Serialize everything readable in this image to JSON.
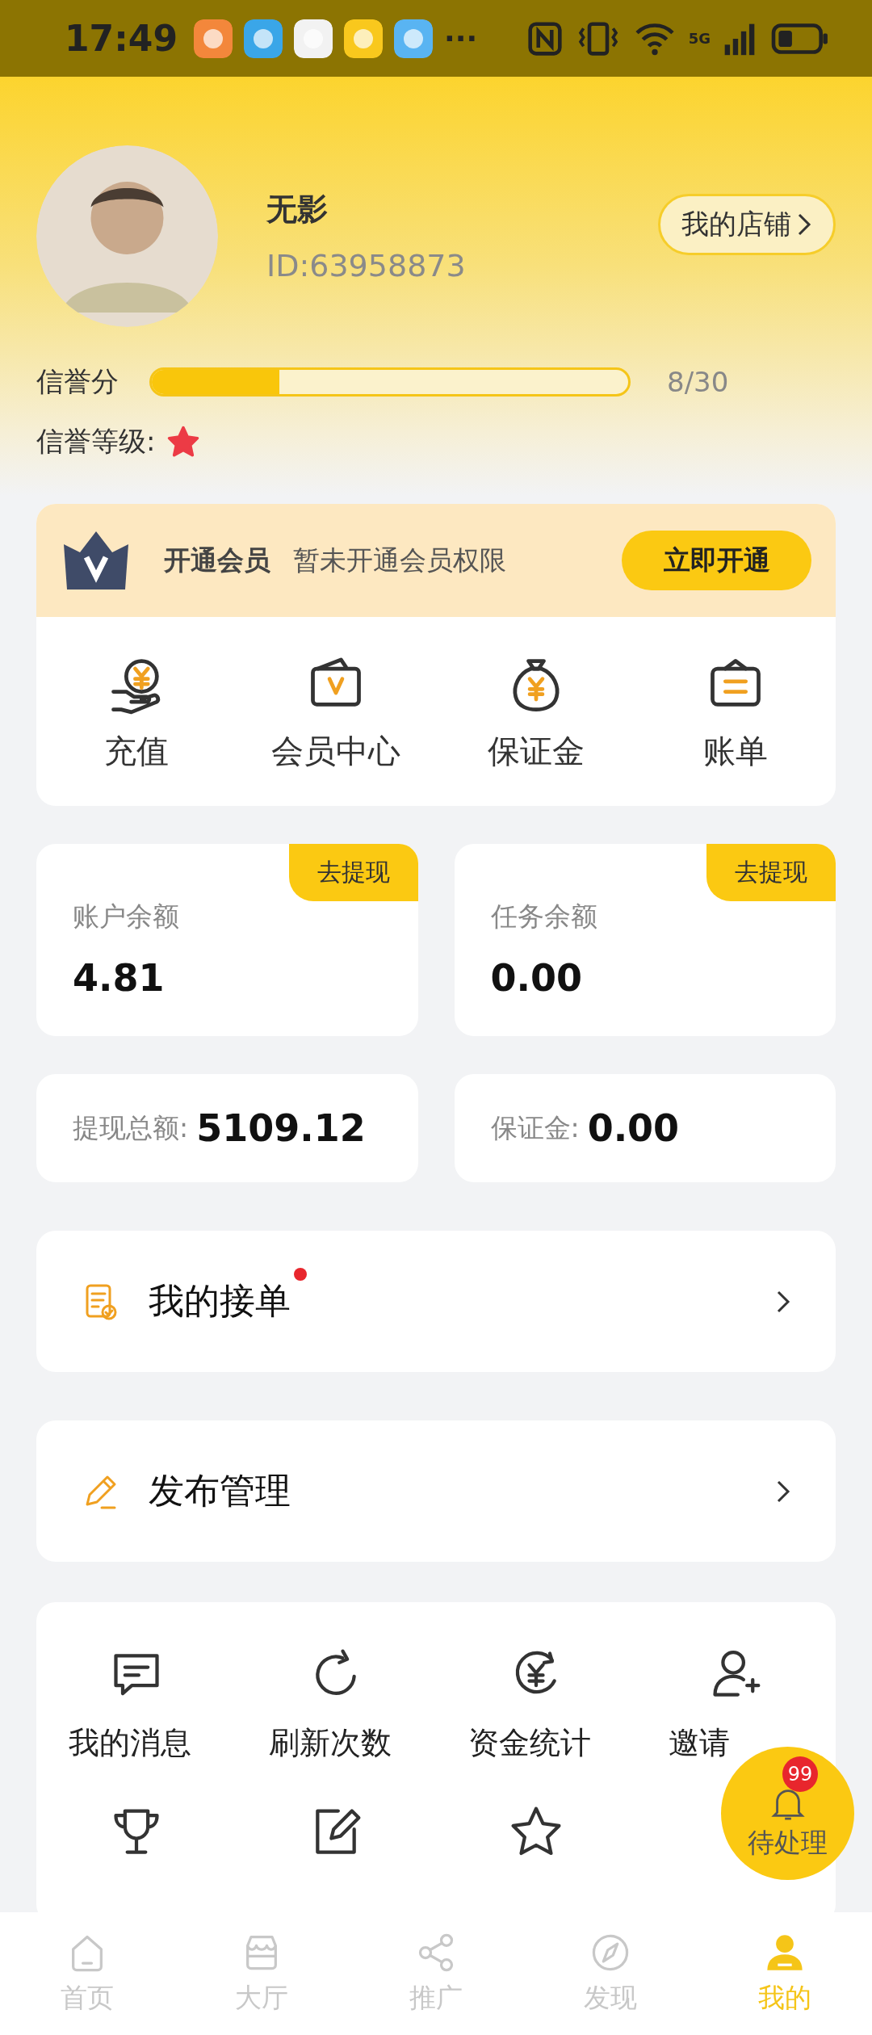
{
  "status_bar": {
    "time": "17:49",
    "more": "···",
    "network": "5G"
  },
  "profile": {
    "name": "无影",
    "id": "ID:63958873",
    "store_button": "我的店铺"
  },
  "credit": {
    "label": "信誉分",
    "level": 0.267,
    "reading": "8/30"
  },
  "credit_level": {
    "label": "信誉等级:"
  },
  "membership": {
    "title": "开通会员",
    "note": "暂未开通会员权限",
    "button": "立即开通"
  },
  "quick_actions": [
    {
      "label": "充值",
      "kind": "topup"
    },
    {
      "label": "会员中心",
      "kind": "vip"
    },
    {
      "label": "保证金",
      "kind": "moneybag"
    },
    {
      "label": "账单",
      "kind": "bill"
    }
  ],
  "balances": [
    {
      "label": "账户余额",
      "value": "4.81",
      "action": "去提现"
    },
    {
      "label": "任务余额",
      "value": "0.00",
      "action": "去提现"
    }
  ],
  "totals": [
    {
      "label": "提现总额:",
      "value": "5109.12"
    },
    {
      "label": "保证金:",
      "value": "0.00"
    }
  ],
  "menu": [
    {
      "label": "我的接单",
      "kind": "orders",
      "unread": true
    },
    {
      "label": "发布管理",
      "kind": "publish",
      "unread": false
    }
  ],
  "tools": [
    {
      "label": "我的消息",
      "kind": "message"
    },
    {
      "label": "刷新次数",
      "kind": "refresh"
    },
    {
      "label": "资金统计",
      "kind": "funds"
    },
    {
      "label": "邀请",
      "kind": "invite"
    },
    {
      "kind": "trophy"
    },
    {
      "kind": "edit"
    },
    {
      "kind": "star"
    }
  ],
  "floating_button": {
    "label": "待处理",
    "badge": "99"
  },
  "nav": [
    {
      "label": "首页",
      "kind": "home",
      "selected": false
    },
    {
      "label": "大厅",
      "kind": "hall",
      "selected": false
    },
    {
      "label": "推广",
      "kind": "share",
      "selected": false
    },
    {
      "label": "发现",
      "kind": "discover",
      "selected": false
    },
    {
      "label": "我的",
      "kind": "me",
      "selected": true
    }
  ]
}
